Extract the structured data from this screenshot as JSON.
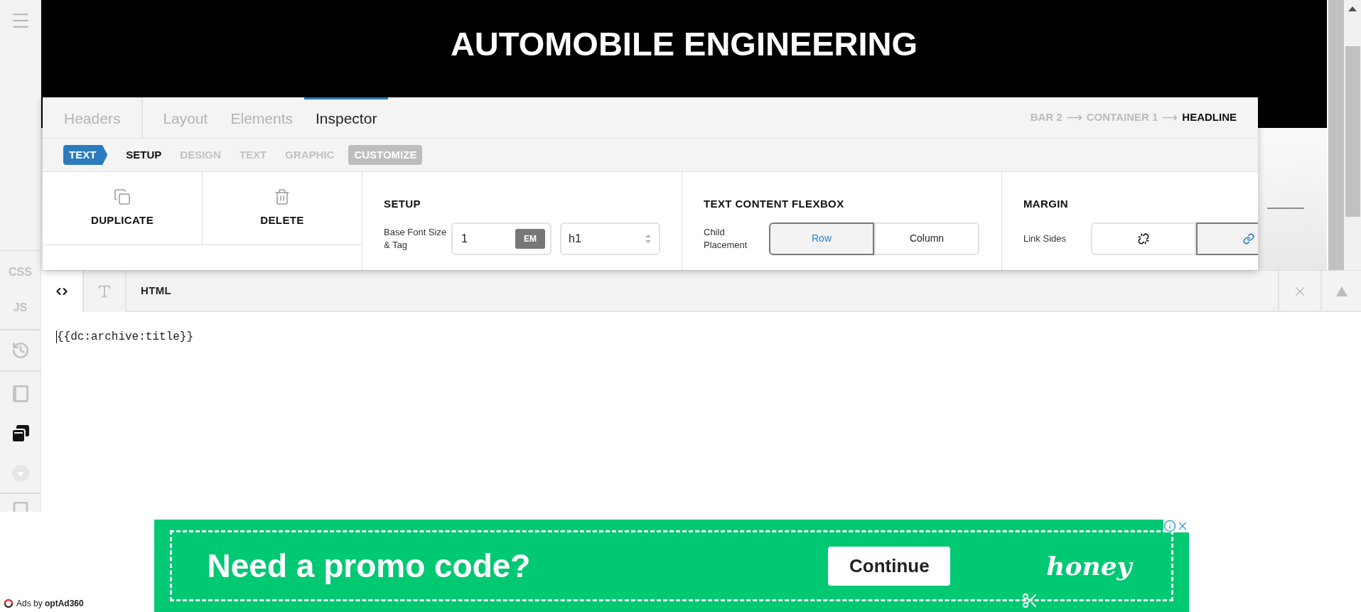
{
  "sidebar": {
    "labels": [
      "CSS",
      "JS"
    ],
    "tools": [
      {
        "kind": "history",
        "selected": false
      },
      {
        "kind": "panel",
        "selected": false
      },
      {
        "kind": "layers",
        "selected": true
      },
      {
        "kind": "down",
        "selected": false
      },
      {
        "kind": "page",
        "selected": false
      }
    ]
  },
  "page": {
    "title": "AUTOMOBILE ENGINEERING"
  },
  "inspector": {
    "tabs": [
      {
        "label": "Headers",
        "selected": false
      },
      {
        "label": "Layout",
        "selected": false
      },
      {
        "label": "Elements",
        "selected": false
      },
      {
        "label": "Inspector",
        "selected": true
      }
    ],
    "breadcrumb": [
      {
        "label": "BAR 2",
        "current": false
      },
      {
        "label": "CONTAINER 1",
        "current": false
      },
      {
        "label": "HEADLINE",
        "current": true
      }
    ],
    "separator": "⟶",
    "element_type": "TEXT",
    "subtabs": [
      {
        "label": "SETUP",
        "kind": "tab",
        "selected": true
      },
      {
        "label": "DESIGN",
        "kind": "tab",
        "selected": false
      },
      {
        "label": "TEXT",
        "kind": "tab",
        "selected": false
      },
      {
        "label": "GRAPHIC",
        "kind": "tab",
        "selected": false
      },
      {
        "label": "CUSTOMIZE",
        "kind": "badge",
        "selected": false
      }
    ],
    "actions": [
      {
        "label": "DUPLICATE",
        "kind": "duplicate"
      },
      {
        "label": "DELETE",
        "kind": "delete"
      }
    ],
    "setup": {
      "title": "SETUP",
      "label": "Base Font Size & Tag",
      "value": "1",
      "unit": "EM",
      "tag": "h1"
    },
    "flexbox": {
      "title": "TEXT CONTENT FLEXBOX",
      "label": "Child Placement",
      "options": [
        {
          "label": "Row",
          "selected": true
        },
        {
          "label": "Column",
          "selected": false
        }
      ]
    },
    "margin": {
      "title": "MARGIN",
      "label": "Link Sides",
      "options": [
        {
          "kind": "unlink",
          "selected": false
        },
        {
          "kind": "link",
          "selected": true
        }
      ]
    }
  },
  "editor": {
    "tabs": [
      {
        "kind": "code",
        "selected": true
      },
      {
        "kind": "text",
        "selected": false
      }
    ],
    "title": "HTML",
    "code": "{{dc:archive:title}}"
  },
  "ad": {
    "headline": "Need a promo code?",
    "button": "Continue",
    "brand": "honey",
    "attribution": "Ads by",
    "provider": "optAd360"
  }
}
